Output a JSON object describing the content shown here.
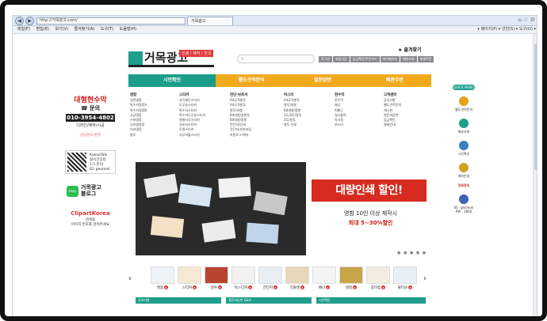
{
  "browser": {
    "address": "http://거목광고.com/",
    "tab_title": "거목광고",
    "menu": [
      "파일(F)",
      "편집(E)",
      "보기(V)",
      "즐겨찾기(A)",
      "도구(T)",
      "도움말(H)"
    ],
    "command_bar": "▾ 페이지(P) ▾ 안전(S) ▾ 도구(O) ▾"
  },
  "site": {
    "logo_text": "거목광고",
    "logo_tag": "인쇄 / 제작 / 전국",
    "search_placeholder": "",
    "top_links": [
      "로그인",
      "회원가입",
      "입금확인/주문하기",
      "마이페이지",
      "배송조회",
      "현재주문"
    ],
    "favorite": "즐겨찾기",
    "nav": [
      "시안확인",
      "웹도견적문의",
      "질문답변",
      "빠른주문"
    ],
    "categories": [
      {
        "title": "명함",
        "items": [
          "일반명함",
          "특수지명함A",
          "특수지명함B",
          "고급명함",
          "수퍼명함",
          "디지털명함",
          "이코명함",
          "봉투"
        ]
      },
      {
        "title": "스티커",
        "items": [
          "사각재단스티커",
          "도무송스티커",
          "특수지스티커",
          "특수지도무송스티커",
          "원형사각스티커",
          "유포지스티커",
          "투명스티커",
          "리무버블스티커"
        ]
      },
      {
        "title": "전단·브로셔",
        "items": [
          "A4규격봉투",
          "A4규격봉투",
          "봉투/대봉",
          "B4대봉/중봉투",
          "B4대봉/중봉",
          "전단지/인쇄",
          "전단지/부분코팅",
          "카탈로그/책자"
        ]
      },
      {
        "title": "마스터",
        "items": [
          "A4규격봉투",
          "봉투/대봉",
          "B4대봉/중봉",
          "1도/2도/봉투",
          "2도/봉투",
          "봉투 인쇄"
        ]
      },
      {
        "title": "현수막",
        "items": [
          "현수막",
          "배너",
          "X배너",
          "실사출력",
          "아크릴",
          "포스터"
        ]
      },
      {
        "title": "고객센터",
        "items": [
          "공지사항",
          "웹도견적문의",
          "게시판",
          "질문과답변",
          "입금확인",
          "결제안내"
        ]
      }
    ],
    "banner": {
      "title": "대량인쇄 할인!",
      "line1": "명함 10인 이상 제작시",
      "line2": "최대 5~30%할인",
      "dots": "● ● ● ● ●"
    },
    "products": [
      {
        "label": "명함"
      },
      {
        "label": "스티커"
      },
      {
        "label": "봉투"
      },
      {
        "label": "독스티커"
      },
      {
        "label": "전단지"
      },
      {
        "label": "리플렛"
      },
      {
        "label": "배너"
      },
      {
        "label": "명찰"
      },
      {
        "label": "종이컵"
      },
      {
        "label": "물티슈"
      }
    ],
    "bottom_bars": [
      "공지사항",
      "질문과답변 Q&A",
      "시안확인"
    ],
    "left": {
      "company": "대형현수막",
      "contact": "문의",
      "phone": "010-3954-4802",
      "sub": "디자인/제작/시공",
      "consult": "상담문의 환영",
      "kakao_title": "KakaoTalk",
      "kakao_sub1": "실시간상담",
      "kakao_sub2": "1:1 문의",
      "kakao_id": "ID: geomok",
      "blog_title": "거목광고",
      "blog_sub": "블로그",
      "blog_icon": "blog",
      "clip_title": "ClipartKorea",
      "clip_sub1": "검색용",
      "clip_sub2": "이미지 번호를 알려주세요"
    },
    "right": {
      "quick": "QUICK MENU",
      "items": [
        {
          "label": "웹도견적문의",
          "color": "#e0a21a"
        },
        {
          "label": "배송조회",
          "color": "#1f9e8c"
        },
        {
          "label": "시안확인",
          "color": "#3d7fb8"
        },
        {
          "label": "계좌안내",
          "color": "#d4a022"
        }
      ],
      "callcenter": "전화문의",
      "phone1": "ID : geomok",
      "phone2": "PW : 3840"
    }
  }
}
